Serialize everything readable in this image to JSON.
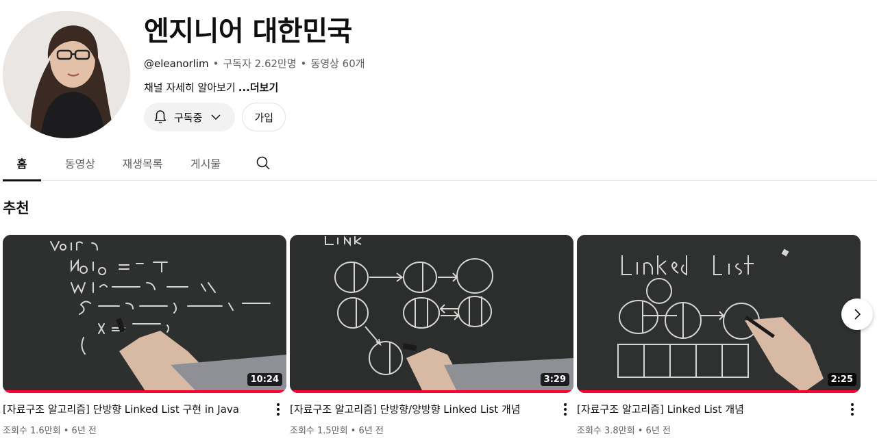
{
  "channel": {
    "title": "엔지니어 대한민국",
    "handle": "@eleanorlim",
    "subscribers": "구독자 2.62만명",
    "videos_count": "동영상 60개",
    "description": "채널 자세히 알아보기",
    "more_label": "...더보기",
    "subscribe_label": "구독중",
    "join_label": "가입"
  },
  "tabs": [
    {
      "label": "홈",
      "active": true
    },
    {
      "label": "동영상"
    },
    {
      "label": "재생목록"
    },
    {
      "label": "게시물"
    }
  ],
  "section_title": "추천",
  "videos": [
    {
      "title": "[자료구조 알고리즘] 단방향 Linked List 구현 in Java",
      "views": "조회수 1.6만회",
      "age": "6년 전",
      "duration": "10:24"
    },
    {
      "title": "[자료구조 알고리즘] 단방향/양방향 Linked List 개념",
      "views": "조회수 1.5만회",
      "age": "6년 전",
      "duration": "3:29"
    },
    {
      "title": "[자료구조 알고리즘] Linked List 개념",
      "views": "조회수 3.8만회",
      "age": "6년 전",
      "duration": "2:25"
    }
  ],
  "icons": {
    "bell": "bell-icon",
    "chevron": "chevron-down-icon",
    "search": "search-icon",
    "more": "more-vert-icon",
    "next": "chevron-right-icon"
  },
  "colors": {
    "progress": "#ff0033",
    "text_primary": "#0f0f0f",
    "text_secondary": "#606060"
  }
}
